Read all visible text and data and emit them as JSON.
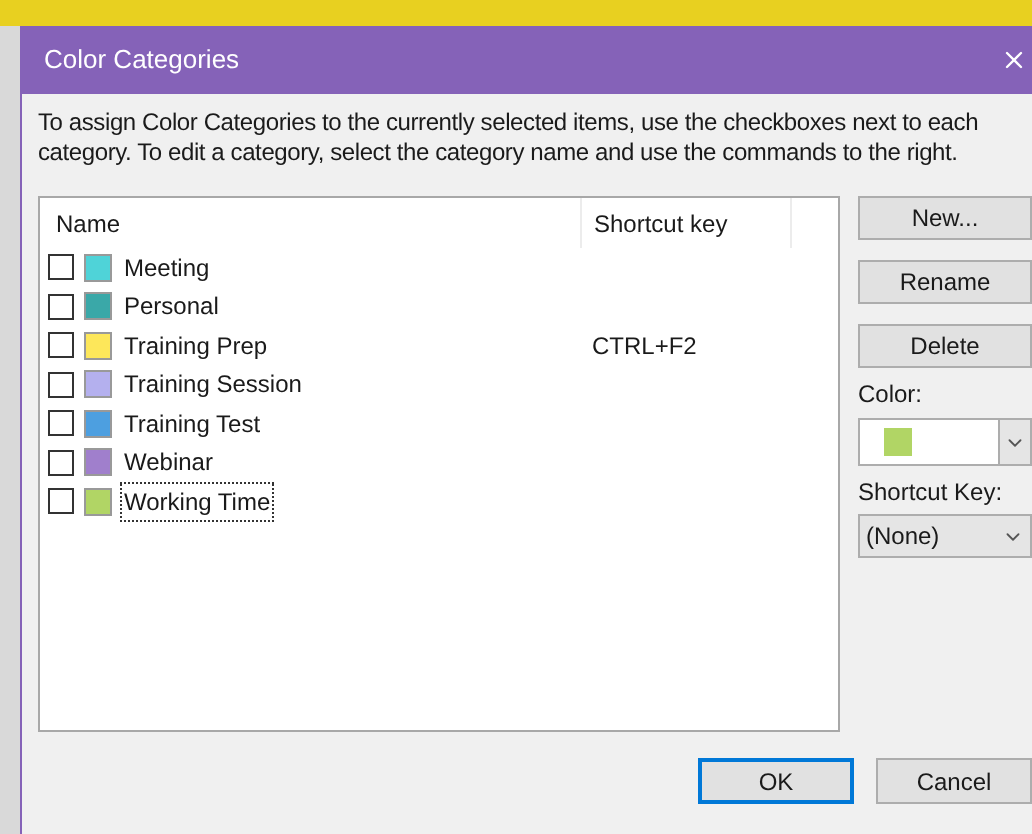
{
  "window": {
    "title": "Color Categories"
  },
  "description": "To assign Color Categories to the currently selected items, use the checkboxes next to each category.  To edit a category, select the category name and use the commands to the right.",
  "list": {
    "columns": [
      "Name",
      "Shortcut key"
    ],
    "rows": [
      {
        "name": "Meeting",
        "color": "#4fd3d8",
        "checked": false,
        "selected": false,
        "shortcut": ""
      },
      {
        "name": "Personal",
        "color": "#3aa8a8",
        "checked": false,
        "selected": false,
        "shortcut": ""
      },
      {
        "name": "Training Prep",
        "color": "#fde75a",
        "checked": false,
        "selected": false,
        "shortcut": "CTRL+F2"
      },
      {
        "name": "Training Session",
        "color": "#b4b0ee",
        "checked": false,
        "selected": false,
        "shortcut": ""
      },
      {
        "name": "Training Test",
        "color": "#4d9fe0",
        "checked": false,
        "selected": false,
        "shortcut": ""
      },
      {
        "name": "Webinar",
        "color": "#a07fcc",
        "checked": false,
        "selected": false,
        "shortcut": ""
      },
      {
        "name": "Working Time",
        "color": "#b1d565",
        "checked": false,
        "selected": true,
        "shortcut": ""
      }
    ]
  },
  "side_buttons": [
    "New...",
    "Rename",
    "Delete"
  ],
  "color_picker": {
    "label": "Color:",
    "color": "#b1d565"
  },
  "shortcut_picker": {
    "label": "Shortcut Key:",
    "value": "(None)"
  },
  "buttons": [
    {
      "label": "OK",
      "default": true
    },
    {
      "label": "Cancel",
      "default": false
    }
  ]
}
